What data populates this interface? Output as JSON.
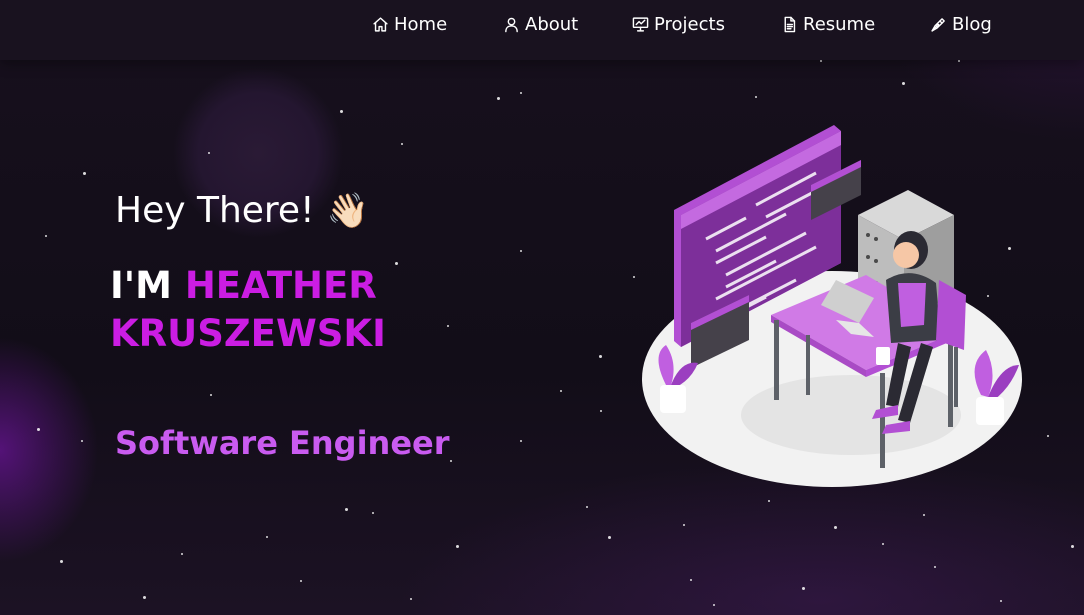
{
  "nav": {
    "items": [
      {
        "label": "Home",
        "icon": "home-icon"
      },
      {
        "label": "About",
        "icon": "user-icon"
      },
      {
        "label": "Projects",
        "icon": "presentation-icon"
      },
      {
        "label": "Resume",
        "icon": "document-icon"
      },
      {
        "label": "Blog",
        "icon": "pen-icon"
      }
    ]
  },
  "hero": {
    "greeting": "Hey There!",
    "wave_emoji": "👋🏻",
    "intro_prefix": "I'M",
    "name_line1": "HEATHER",
    "name_line2": "KRUSZEWSKI",
    "role": "Software Engineer"
  },
  "colors": {
    "background": "#150f1c",
    "navbar": "#19121f",
    "name_accent": "#cb1de3",
    "role_accent": "#c95bf0",
    "illustration_purple": "#b24fd3"
  }
}
